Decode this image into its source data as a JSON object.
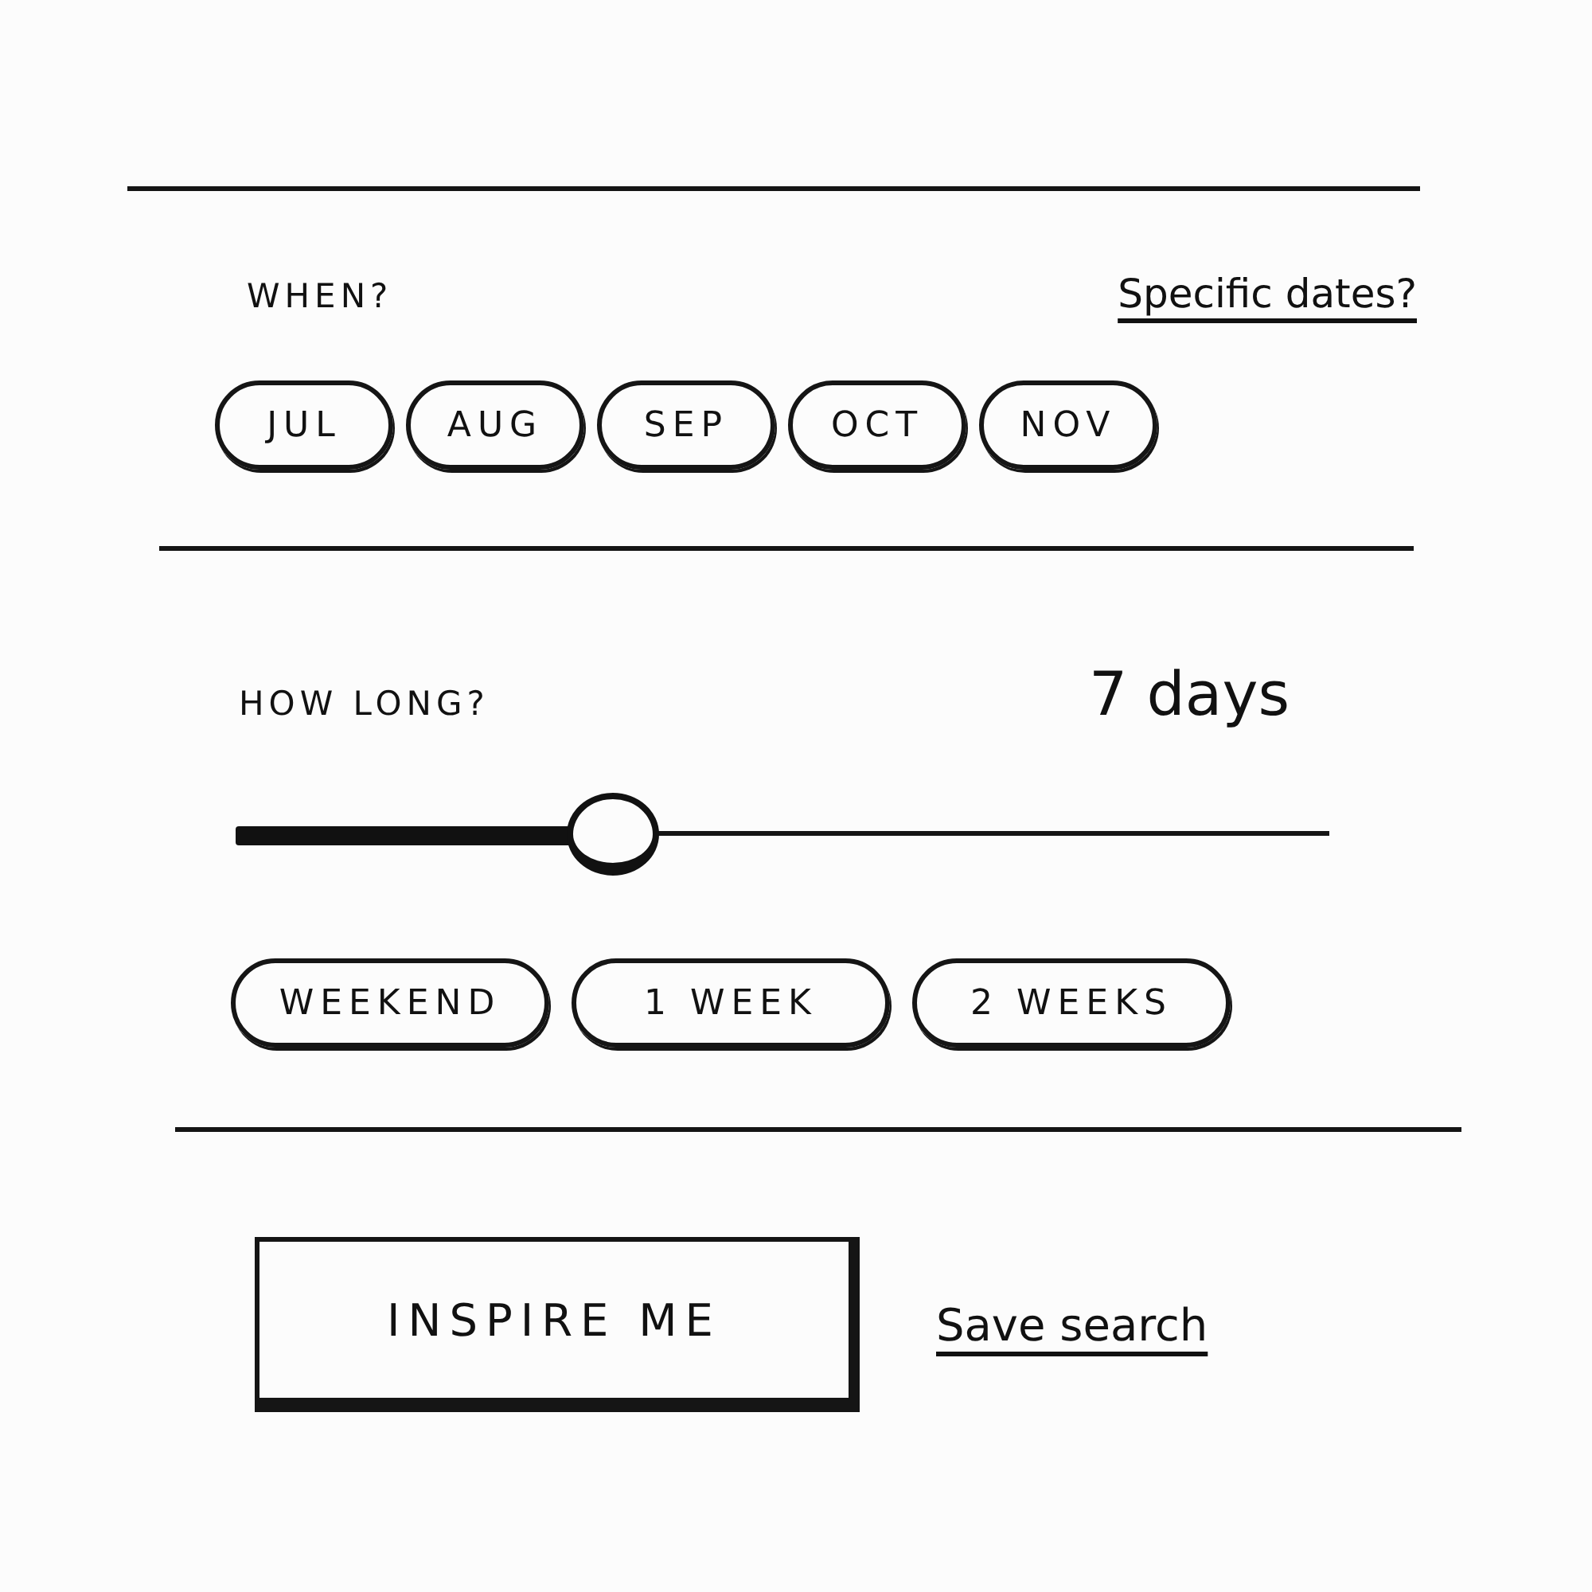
{
  "when": {
    "label": "WHEN?",
    "specific_dates_link": "Specific dates?",
    "months": [
      {
        "label": "JUL",
        "selected": false
      },
      {
        "label": "AUG",
        "selected": false
      },
      {
        "label": "SEP",
        "selected": false
      },
      {
        "label": "OCT",
        "selected": false
      },
      {
        "label": "NOV",
        "selected": false
      }
    ]
  },
  "how_long": {
    "label": "HOW LONG?",
    "reading": "7 days",
    "slider": {
      "level": 0.34
    },
    "presets": [
      {
        "label": "WEEKEND",
        "selected": false
      },
      {
        "label": "1 WEEK",
        "selected": false
      },
      {
        "label": "2 WEEKS",
        "selected": false
      }
    ]
  },
  "actions": {
    "primary_button": "INSPIRE ME",
    "save_link": "Save search"
  }
}
